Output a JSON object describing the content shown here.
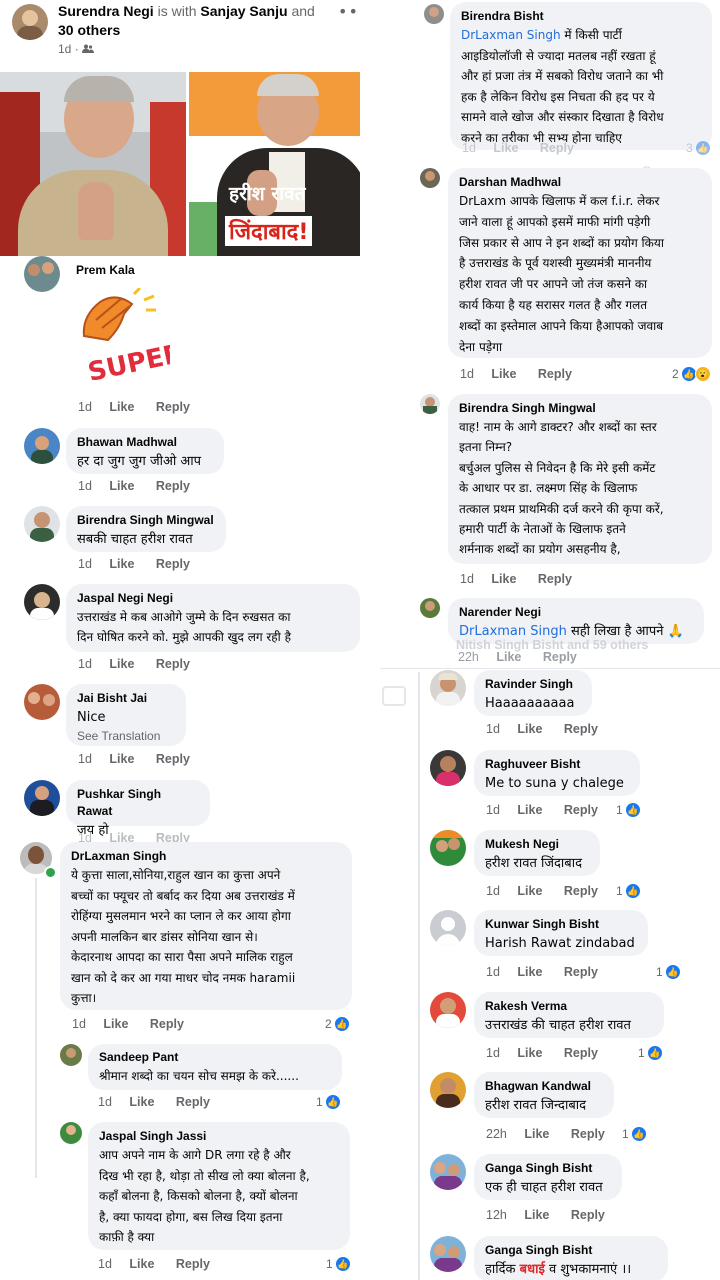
{
  "post": {
    "author": "Surendra Negi",
    "with_text": "is with",
    "tagged": "Sanjay Sanju",
    "and_text": "and",
    "others": "30 others",
    "time": "1d",
    "privacy_icon": "friends-icon",
    "more_icon": "more-icon",
    "image_caption_line1": "हरीश रावत",
    "image_caption_line2": "जिंदाबाद!"
  },
  "actions": {
    "like": "Like",
    "reply": "Reply"
  },
  "left_comments": [
    {
      "name": "Prem Kala",
      "sticker": "SUPER!",
      "time": "1d"
    },
    {
      "name": "Bhawan Madhwal",
      "text": "हर दा जुग जुग जीओ आप",
      "time": "1d"
    },
    {
      "name": "Birendra Singh Mingwal",
      "text": "सबकी चाहत हरीश रावत",
      "time": "1d"
    },
    {
      "name": "Jaspal Negi Negi",
      "text": "उत्तराखंड मे  कब आओगे जुम्मे के दिन रुखसत का\nदिन घोषित करने को. मुझे आपकी खुद लग रही है",
      "time": "1d"
    },
    {
      "name": "Jai Bisht Jai",
      "text": "Nice",
      "see_translation": "See Translation",
      "time": "1d"
    },
    {
      "name": "Pushkar Singh Rawat",
      "text": "जय हो",
      "time": "1d"
    },
    {
      "name": "DrLaxman Singh",
      "text": "ये कुत्ता साला,सोनिया,राहुल खान का कुत्ता अपने\nबच्चों का फ्यूचर तो बर्बाद कर दिया अब उत्तराखंड में\nरोहिंग्या मुसलमान भरने का प्लान ले कर आया होगा\nअपनी मालकिन बार डांसर सोनिया खान से।\nकेदारनाथ आपदा का सारा पैसा अपने मालिक राहुल\nखान को दे कर आ गया माधर चोद नमक haramii\nकुत्ता।",
      "time": "1d",
      "reactions": "2"
    },
    {
      "name": "Sandeep Pant",
      "text": "श्रीमान शब्दो का चयन सोच समझ के करे......",
      "time": "1d",
      "reactions": "1"
    },
    {
      "name": "Jaspal Singh Jassi",
      "text": "आप अपने नाम के आगे DR लगा रहे है और\nदिख भी रहा है, थोड़ा तो सीख लो क्या बोलना है,\nकहाँ बोलना है, किसको बोलना है, क्यों बोलना\nहै, क्या फायदा होगा, बस लिख दिया इतना\nकाफ़ी है क्या",
      "time": "1d",
      "reactions": "1"
    }
  ],
  "right_comments": [
    {
      "name": "Birendra Bisht",
      "mention": "DrLaxman Singh",
      "text": " में किसी पार्टी\nआइडियोलॉजी से ज्यादा मतलब नहीं रखता हूं\nऔर हां प्रजा तंत्र में सबको विरोध जताने का भी\nहक है लेकिन विरोध इस निचता की हद पर ये\nसामने वाले खोज और संस्कार दिखाता है विरोध\nकरने का तरीका भी सभ्य होना चाहिए",
      "time": "1d",
      "reactions": "3"
    },
    {
      "name": "Darshan Madhwal",
      "text": "DrLaxm आपके खिलाफ में कल f.i.r. लेकर\nजाने वाला हूं आपको इसमें माफी मांगी पड़ेगी\nजिस प्रकार से आप ने इन शब्दों का प्रयोग किया\nहै उत्तराखंड के पूर्व यशस्वी मुख्यमंत्री माननीय\nहरीश रावत जी  पर आपने जो तंज कसने का\nकार्य किया है यह सरासर गलत है और गलत\nशब्दों का इस्तेमाल आपने किया हैआपको जवाब\nदेना पड़ेगा",
      "time": "1d",
      "reactions": "2"
    },
    {
      "name": "Birendra Singh Mingwal",
      "text": "वाह! नाम के आगे डाक्टर? और शब्दों का स्तर\nइतना निम्न?\n बर्चुअल पुलिस से निवेदन है कि मेरे इसी कमेंट\nके आधार पर डा. लक्ष्मण सिंह के खिलाफ\nतत्काल प्रथम प्राथमिकी दर्ज करने की कृपा करें,\n   हमारी पार्टी के नेताओं के खिलाफ इतने\nशर्मनाक शब्दों का प्रयोग असहनीय है,",
      "time": "1d"
    },
    {
      "name": "Narender Negi",
      "mention": "DrLaxman Singh",
      "text": " सही लिखा है आपने 🙏",
      "time": "22h",
      "ghost": "Nitish Singh Bisht and 59 others"
    },
    {
      "name": "Ravinder Singh",
      "text": "Haaaaaaaaaa",
      "time": "1d"
    },
    {
      "name": "Raghuveer Bisht",
      "text": "Me to suna y chalege",
      "time": "1d",
      "reactions": "1"
    },
    {
      "name": "Mukesh Negi",
      "text": "हरीश रावत जिंदाबाद",
      "time": "1d",
      "reactions": "1"
    },
    {
      "name": "Kunwar Singh Bisht",
      "text": "Harish Rawat zindabad",
      "time": "1d",
      "reactions": "1"
    },
    {
      "name": "Rakesh Verma",
      "text": "उत्तराखंड की चाहत हरीश रावत",
      "time": "1d",
      "reactions": "1"
    },
    {
      "name": "Bhagwan Kandwal",
      "text": "हरीश रावत जिन्दाबाद",
      "time": "22h",
      "reactions": "1"
    },
    {
      "name": "Ganga Singh Bisht",
      "text": "एक ही चाहत हरीश रावत",
      "time": "12h"
    },
    {
      "name": "Ganga Singh Bisht",
      "text_pre": "हार्दिक ",
      "text_highlight": "बधाई",
      "text_post": " व शुभकामनाएं ।।"
    }
  ],
  "colors": {
    "accent": "#216fdb",
    "like_blue": "#1877f2",
    "bubble": "#f0f2f5",
    "meta": "#65676b"
  }
}
